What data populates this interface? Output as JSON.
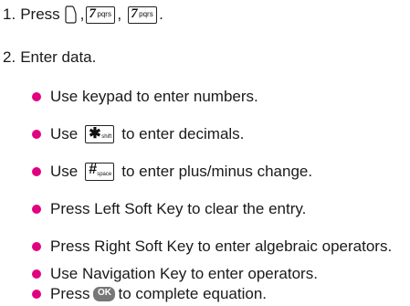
{
  "steps": [
    {
      "number": "1.",
      "verb": "Press",
      "keys": [
        {
          "icon": "soft-key-icon"
        },
        {
          "icon": "key-7pqrs-icon",
          "digit": "7",
          "letters": "pqrs"
        },
        {
          "icon": "key-7pqrs-icon",
          "digit": "7",
          "letters": "pqrs"
        }
      ],
      "sep1": ",",
      "sep2": ",",
      "end": "."
    },
    {
      "number": "2.",
      "text": "Enter data."
    }
  ],
  "bullets": {
    "b1": "Use keypad to enter numbers.",
    "b2_pre": "Use",
    "b2_post": "to enter decimals.",
    "b3_pre": "Use",
    "b3_post": "to enter plus/minus change.",
    "b4": "Press Left Soft Key to clear the entry.",
    "b5": "Press Right Soft Key to enter algebraic operators.",
    "b6": "Use Navigation Key to enter operators.",
    "b7_pre": "Press",
    "b7_post": "to complete equation."
  },
  "keys": {
    "star_sym": "✱",
    "star_sub_top": "⁵⁵",
    "star_sub_bottom": "shift",
    "hash_sym": "#",
    "hash_sub_top": "🔒",
    "hash_sub_bottom": "space",
    "ok_label": "OK",
    "seven_digit": "7",
    "seven_letters": "pqrs"
  },
  "colors": {
    "bullet": "#e3007f",
    "ok_key": "#777777",
    "text": "#1a1a1a"
  }
}
